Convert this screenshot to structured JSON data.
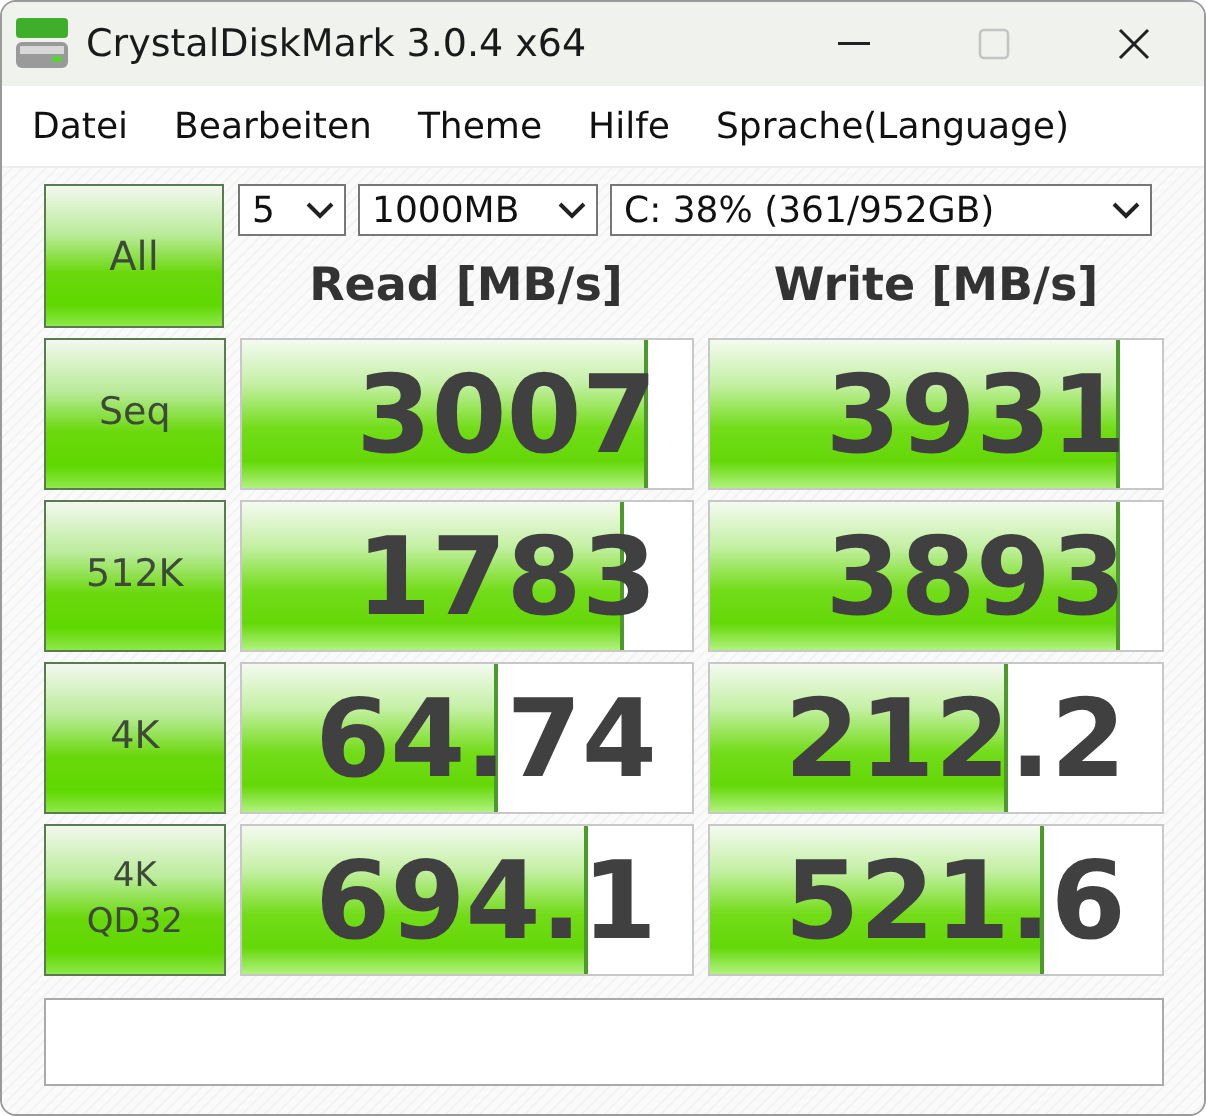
{
  "window": {
    "title": "CrystalDiskMark 3.0.4 x64",
    "maximize_enabled": false
  },
  "menu": [
    "Datei",
    "Bearbeiten",
    "Theme",
    "Hilfe",
    "Sprache(Language)"
  ],
  "controls": {
    "all_button": "All",
    "count": "5",
    "size": "1000MB",
    "drive": "C: 38% (361/952GB)"
  },
  "headers": {
    "read": "Read [MB/s]",
    "write": "Write [MB/s]"
  },
  "rows": [
    {
      "label": [
        "Seq"
      ],
      "read": {
        "value": "3007",
        "level": 0.89
      },
      "write": {
        "value": "3931",
        "level": 0.9
      }
    },
    {
      "label": [
        "512K"
      ],
      "read": {
        "value": "1783",
        "level": 0.84
      },
      "write": {
        "value": "3893",
        "level": 0.9
      }
    },
    {
      "label": [
        "4K"
      ],
      "read": {
        "value": "64.74",
        "level": 0.56
      },
      "write": {
        "value": "212.2",
        "level": 0.65
      }
    },
    {
      "label": [
        "4K",
        "QD32"
      ],
      "read": {
        "value": "694.1",
        "level": 0.76
      },
      "write": {
        "value": "521.6",
        "level": 0.73
      }
    }
  ]
}
